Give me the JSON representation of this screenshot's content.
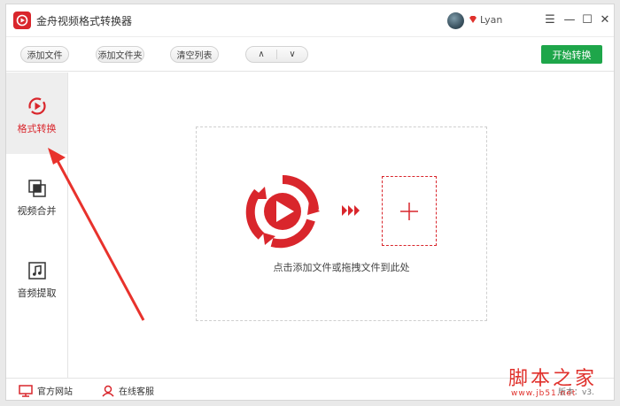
{
  "app": {
    "title": "金舟视频格式转换器",
    "username": "Lyan"
  },
  "window_controls": {
    "menu": "☰",
    "minimize": "—",
    "maximize": "☐",
    "close": "✕"
  },
  "toolbar": {
    "add_file": "添加文件",
    "add_folder": "添加文件夹",
    "clear_list": "清空列表",
    "move_up": "∧",
    "move_down": "∨",
    "start": "开始转换"
  },
  "sidebar": {
    "items": [
      {
        "label": "格式转换",
        "icon": "convert-play-icon",
        "active": true
      },
      {
        "label": "视频合并",
        "icon": "merge-icon",
        "active": false
      },
      {
        "label": "音频提取",
        "icon": "music-note-icon",
        "active": false
      }
    ]
  },
  "dropzone": {
    "hint": "点击添加文件或拖拽文件到此处",
    "add_symbol": "+"
  },
  "footer": {
    "official_site": "官方网站",
    "online_service": "在线客服",
    "version": "版本：v3."
  },
  "watermark": {
    "main": "脚本之家",
    "sub": "www.jb51.net"
  },
  "colors": {
    "brand_red": "#d9262c",
    "start_green": "#1ea64a"
  }
}
